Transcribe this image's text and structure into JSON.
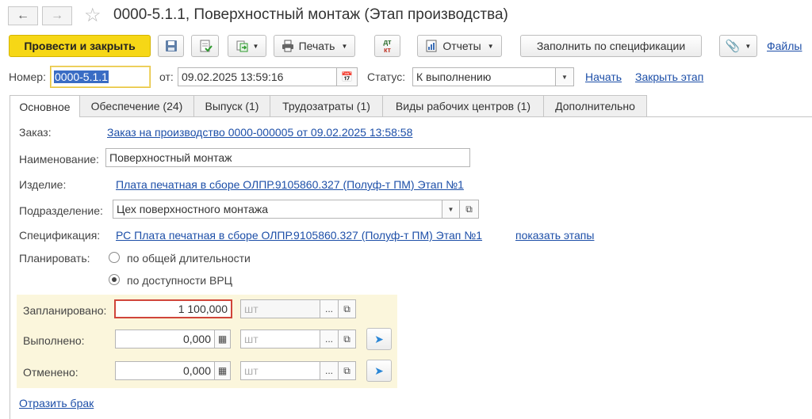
{
  "window": {
    "title": "0000-5.1.1, Поверхностный монтаж (Этап производства)"
  },
  "toolbar": {
    "post_close_label": "Провести и закрыть",
    "print_label": "Печать",
    "dtkt_label_top": "дт",
    "dtkt_label_bottom": "кт",
    "reports_label": "Отчеты",
    "fill_spec_label": "Заполнить по спецификации",
    "files_label": "Файлы"
  },
  "header": {
    "number_label": "Номер:",
    "number_value": "0000-5.1.1",
    "date_label": "от:",
    "date_value": "09.02.2025 13:59:16",
    "status_label": "Статус:",
    "status_value": "К выполнению",
    "start_link": "Начать",
    "close_stage_link": "Закрыть этап"
  },
  "tabs": [
    {
      "label": "Основное"
    },
    {
      "label": "Обеспечение (24)"
    },
    {
      "label": "Выпуск (1)"
    },
    {
      "label": "Трудозатраты (1)"
    },
    {
      "label": "Виды рабочих центров (1)"
    },
    {
      "label": "Дополнительно"
    }
  ],
  "form": {
    "order_label": "Заказ:",
    "order_link": "Заказ на производство 0000-000005 от 09.02.2025 13:58:58",
    "name_label": "Наименование:",
    "name_value": "Поверхностный монтаж",
    "product_label": "Изделие:",
    "product_link": "Плата печатная в сборе ОЛПР.9105860.327 (Полуф-т ПМ) Этап №1",
    "department_label": "Подразделение:",
    "department_value": "Цех поверхностного монтажа",
    "spec_label": "Спецификация:",
    "spec_link": "РС  Плата печатная в сборе ОЛПР.9105860.327 (Полуф-т ПМ) Этап №1",
    "show_stages_link": "показать этапы",
    "plan_label": "Планировать:",
    "plan_option1": "по общей длительности",
    "plan_option2": "по доступности ВРЦ",
    "planned_label": "Запланировано:",
    "planned_value": "1 100,000",
    "planned_unit": "шт",
    "done_label": "Выполнено:",
    "done_value": "0,000",
    "done_unit": "шт",
    "cancelled_label": "Отменено:",
    "cancelled_value": "0,000",
    "cancelled_unit": "шт",
    "reflect_defect_link": "Отразить брак"
  },
  "colors": {
    "accent_yellow": "#f6d716",
    "link_blue": "#1d4fa8",
    "highlight_red": "#d0453a",
    "panel_yellow": "#fbf6dc"
  }
}
